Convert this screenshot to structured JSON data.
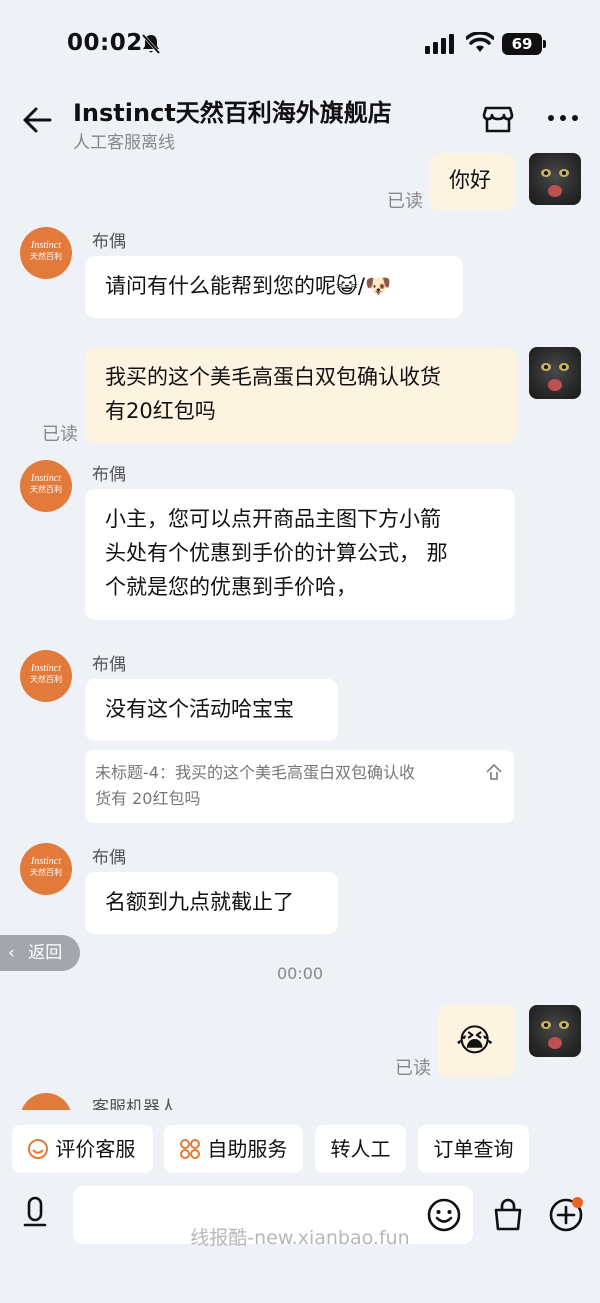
{
  "status_bar": {
    "time": "00:02",
    "battery": "69"
  },
  "header": {
    "title": "Instinct天然百利海外旗舰店",
    "subtitle": "人工客服离线",
    "icons": [
      "back-arrow-icon",
      "shop-icon",
      "more-icon"
    ]
  },
  "shop_avatar": {
    "line1": "Instinct",
    "line2": "天然百利"
  },
  "messages": [
    {
      "side": "right",
      "text": "你好",
      "read": "已读"
    },
    {
      "side": "left",
      "sender": "布偶",
      "text": "请问有什么能帮到您的呢😺/🐶"
    },
    {
      "side": "right",
      "text_lines": [
        "我买的这个美毛高蛋白双包确认收货",
        "有20红包吗"
      ],
      "read": "已读"
    },
    {
      "side": "left",
      "sender": "布偶",
      "text_lines": [
        "小主，您可以点开商品主图下方小箭",
        "头处有个优惠到手价的计算公式， 那",
        "个就是您的优惠到手价哈，"
      ]
    },
    {
      "side": "left",
      "sender": "布偶",
      "text": "没有这个活动哈宝宝",
      "quote_lines": [
        "未标题-4：我买的这个美毛高蛋白双包确认收",
        "货有 20红包吗"
      ]
    },
    {
      "side": "left",
      "sender": "布偶",
      "text": "名额到九点就截止了"
    },
    {
      "side": "right",
      "text": "😭",
      "read": "已读"
    },
    {
      "side": "left",
      "sender": "客服机器人"
    }
  ],
  "timestamp": "00:00",
  "back_pill": "返回",
  "quick_actions": [
    {
      "label": "评价客服",
      "icon": "smiley-icon"
    },
    {
      "label": "自助服务",
      "icon": "grid-icon"
    },
    {
      "label": "转人工"
    },
    {
      "label": "订单查询"
    }
  ],
  "input": {
    "placeholder": ""
  },
  "watermark": "线报酷-new.xianbao.fun",
  "colors": {
    "background": "#eef1f5",
    "accent": "#e27a3c",
    "right_bubble": "#fdf3e1",
    "badge": "#f0612a"
  }
}
